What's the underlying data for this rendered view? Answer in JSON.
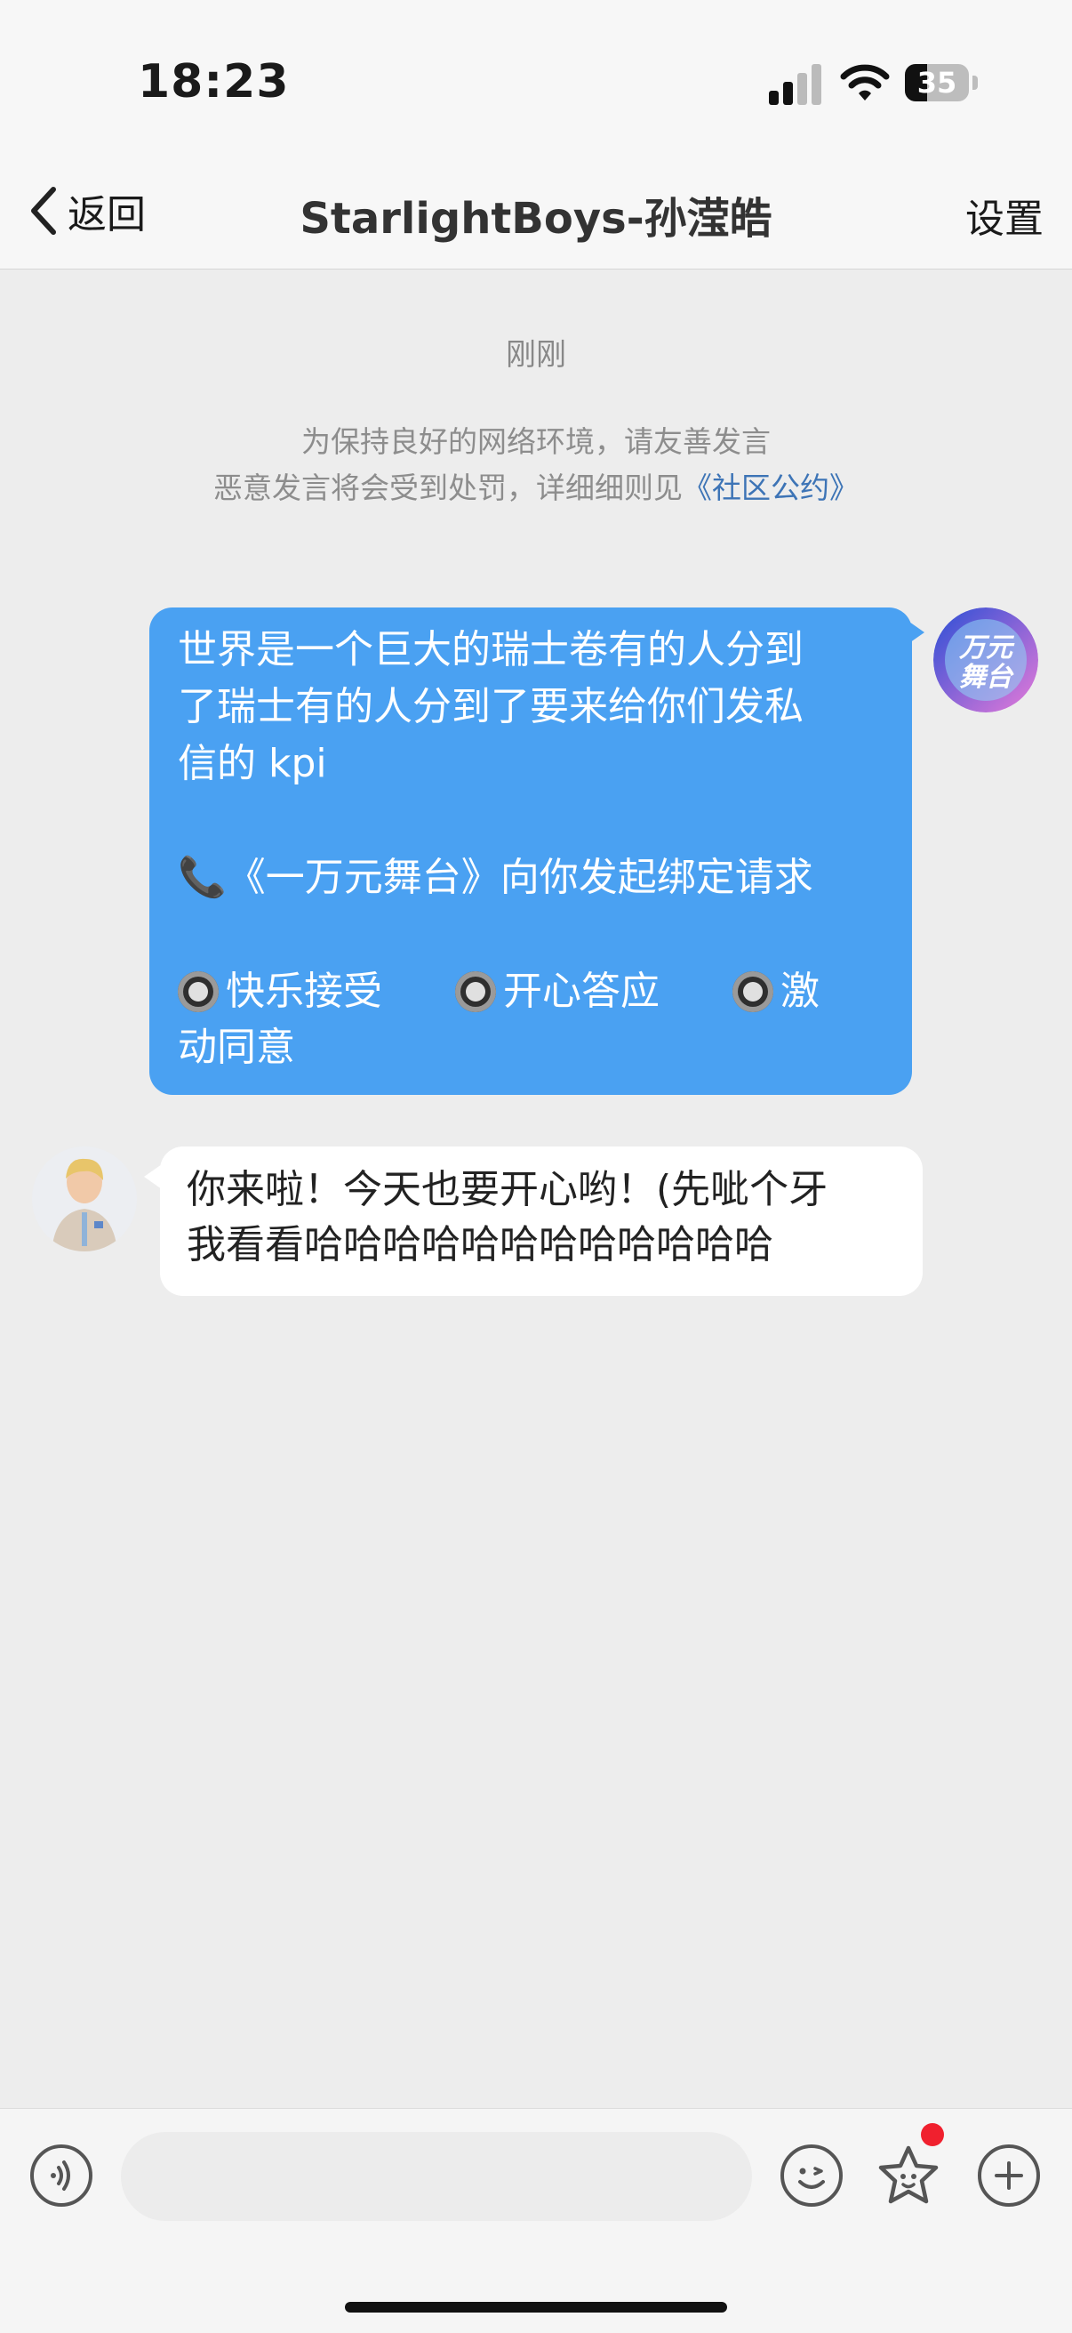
{
  "status_bar": {
    "time": "18:23",
    "battery": "35",
    "battery_level": 0.35
  },
  "nav": {
    "back_label": "返回",
    "title": "StarlightBoys-孙滢皓",
    "settings_label": "设置"
  },
  "chat": {
    "timestamp": "刚刚",
    "notice_line1": "为保持良好的网络环境，请友善发言",
    "notice_line2_prefix": "恶意发言将会受到处罚，详细细则见",
    "notice_link": "《社区公约》",
    "outgoing": {
      "avatar_icon": "wanyuan-stage-logo",
      "text_line1": "世界是一个巨大的瑞士卷有的人分到",
      "text_line2": "了瑞士有的人分到了要来给你们发私",
      "text_line3": "信的 kpi",
      "invite_emoji": "📞",
      "invite_text": "《一万元舞台》向你发起绑定请求",
      "option1": "快乐接受",
      "option2": "开心答应",
      "option3_part1": "激",
      "option3_part2": "动同意"
    },
    "incoming": {
      "avatar_icon": "idol-avatar",
      "text_line1": "你来啦！今天也要开心哟！(先呲个牙",
      "text_line2": "我看看哈哈哈哈哈哈哈哈哈哈哈哈"
    }
  },
  "input_bar": {
    "voice_icon": "voice-icon",
    "placeholder": "",
    "emoji_icon": "emoji-icon",
    "sticker_icon": "star-sticker-icon",
    "plus_icon": "plus-icon"
  }
}
